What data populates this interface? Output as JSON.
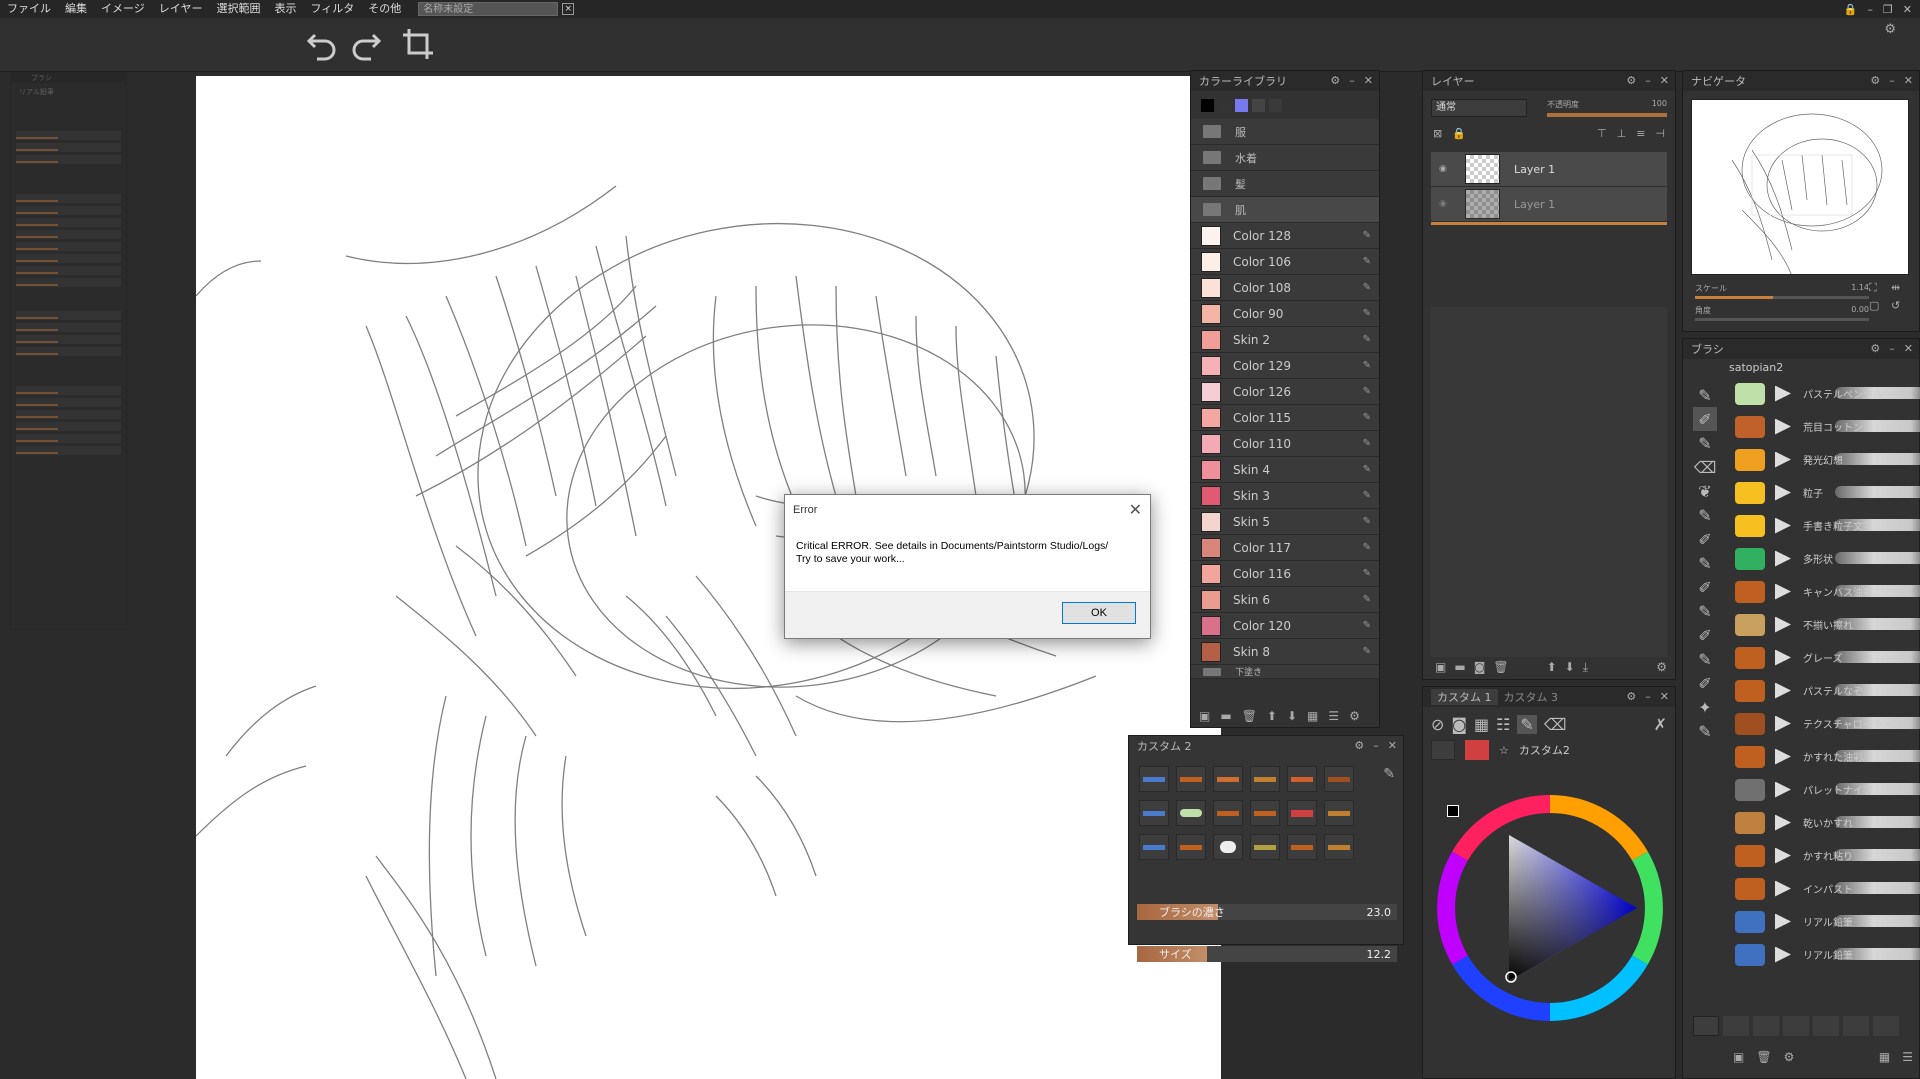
{
  "menubar": {
    "items": [
      "ファイル",
      "編集",
      "イメージ",
      "レイヤー",
      "選択範囲",
      "表示",
      "フィルタ",
      "その他"
    ],
    "document_name": "名称未設定",
    "document_close": "×"
  },
  "window_buttons": [
    "⚙",
    "–",
    "×"
  ],
  "color_library": {
    "title": "カラーライブラリ",
    "folders": [
      "服",
      "水着",
      "髪",
      "肌"
    ],
    "swatches": [
      {
        "name": "Color 128",
        "color": "#fdf3ee"
      },
      {
        "name": "Color 106",
        "color": "#fcefe6"
      },
      {
        "name": "Color 108",
        "color": "#fae2d8"
      },
      {
        "name": "Color 90",
        "color": "#f3b5a5"
      },
      {
        "name": "Skin 2",
        "color": "#f29e98"
      },
      {
        "name": "Color 129",
        "color": "#f5b1b5"
      },
      {
        "name": "Color 126",
        "color": "#f7cdd5"
      },
      {
        "name": "Color 115",
        "color": "#f3a6a2"
      },
      {
        "name": "Color 110",
        "color": "#f4aab5"
      },
      {
        "name": "Skin 4",
        "color": "#ef8f9a"
      },
      {
        "name": "Skin 3",
        "color": "#e05a72"
      },
      {
        "name": "Skin 5",
        "color": "#f6d4ce"
      },
      {
        "name": "Color 117",
        "color": "#d9867a"
      },
      {
        "name": "Color 116",
        "color": "#f2a59a"
      },
      {
        "name": "Skin 6",
        "color": "#e99c8f"
      },
      {
        "name": "Color 120",
        "color": "#d9718a"
      },
      {
        "name": "Skin 8",
        "color": "#b55f46"
      }
    ],
    "folder_under": "下塗き"
  },
  "layers": {
    "title": "レイヤー",
    "blend_mode": "通常",
    "opacity_label": "不透明度",
    "opacity_value": "100",
    "items": [
      {
        "name": "Layer 1"
      },
      {
        "name": "Layer 1"
      }
    ]
  },
  "navigator": {
    "title": "ナビゲータ",
    "scale_label": "スケール",
    "scale_value": "1.14",
    "angle_label": "角度",
    "angle_value": "0.00"
  },
  "brush_panel": {
    "title": "ブラシ",
    "set_name": "satopian2",
    "brushes": [
      {
        "name": "パステルペンシル",
        "tip": "#bfe0a8"
      },
      {
        "name": "荒目コットン",
        "tip": "#c0602a"
      },
      {
        "name": "発光幻想",
        "tip": "#f0a020"
      },
      {
        "name": "粒子",
        "tip": "#f5c020"
      },
      {
        "name": "手書き粒子文字",
        "tip": "#f5c020"
      },
      {
        "name": "多形状",
        "tip": "#30b060"
      },
      {
        "name": "キャンバス油彩",
        "tip": "#c06020"
      },
      {
        "name": "不揃い擦れ",
        "tip": "#c8a060"
      },
      {
        "name": "グレーズ",
        "tip": "#c06020"
      },
      {
        "name": "パステルなぞ",
        "tip": "#c06020"
      },
      {
        "name": "テクスチャローラー",
        "tip": "#a05020"
      },
      {
        "name": "かすれた油彩",
        "tip": "#c06020"
      },
      {
        "name": "パレットナイフ",
        "tip": "#707070"
      },
      {
        "name": "乾いかすれ",
        "tip": "#c08040"
      },
      {
        "name": "かすれ粘り",
        "tip": "#c06020"
      },
      {
        "name": "インパスト",
        "tip": "#c06020"
      },
      {
        "name": "リアル鉛筆",
        "tip": "#4070c0"
      },
      {
        "name": "リアル鉛筆",
        "tip": "#4070c0"
      }
    ]
  },
  "custom2": {
    "title": "カスタム 2",
    "slider1_label": "ブラシの濃さ",
    "slider1_value": "23.0",
    "slider1_level": 0.31,
    "slider2_label": "サイズ",
    "slider2_value": "12.2",
    "slider2_level": 0.27
  },
  "custom_tabs": {
    "tab1": "カスタム 1",
    "tab3": "カスタム 3",
    "preset_name": "カスタム2"
  },
  "dialog": {
    "title": "Error",
    "message_line1": "Critical ERROR. See details in Documents/Paintstorm Studio/Logs/",
    "message_line2": " Try to save your work...",
    "ok_label": "OK",
    "close_glyph": "✕"
  },
  "mini_brush_panel": {
    "title": "ブラシ",
    "subtitle": "リアル鉛筆"
  }
}
